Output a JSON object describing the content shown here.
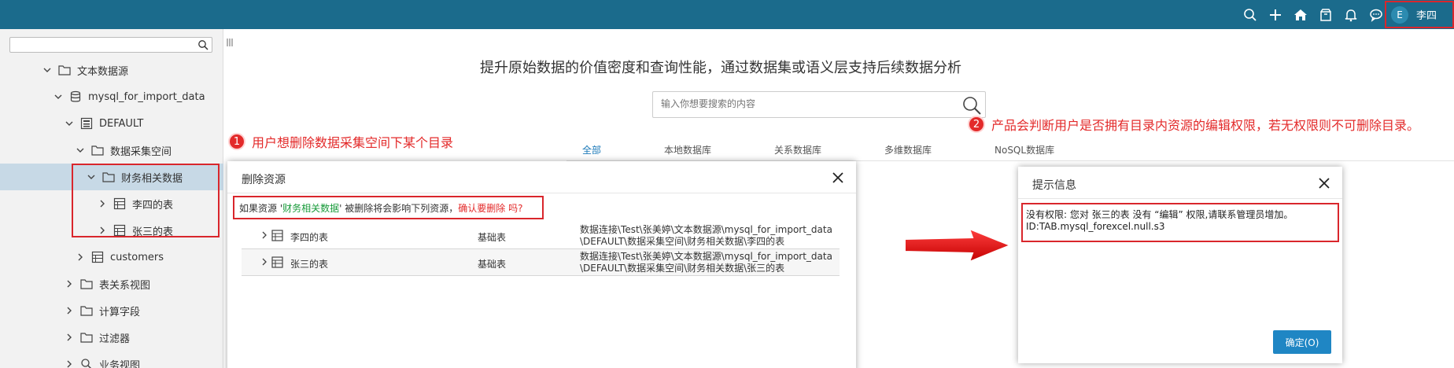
{
  "header": {
    "avatar_letter": "E",
    "user_name": "李四",
    "icons": [
      "search-icon",
      "plus-icon",
      "home-icon",
      "package-icon",
      "bell-icon",
      "chat-icon"
    ]
  },
  "sidebar": {
    "search_placeholder": "",
    "items": [
      {
        "label": "文本数据源",
        "icon": "folder-icon",
        "expanded": true
      },
      {
        "label": "mysql_for_import_data",
        "icon": "database-icon",
        "expanded": true
      },
      {
        "label": "DEFAULT",
        "icon": "schema-icon",
        "expanded": true
      },
      {
        "label": "数据采集空间",
        "icon": "folder-icon",
        "expanded": true
      },
      {
        "label": "财务相关数据",
        "icon": "folder-icon",
        "expanded": true
      },
      {
        "label": "李四的表",
        "icon": "table-icon",
        "expanded": false
      },
      {
        "label": "张三的表",
        "icon": "table-icon",
        "expanded": false
      },
      {
        "label": "customers",
        "icon": "table-icon",
        "expanded": false
      },
      {
        "label": "表关系视图",
        "icon": "folder-icon",
        "expanded": false
      },
      {
        "label": "计算字段",
        "icon": "folder-icon",
        "expanded": false
      },
      {
        "label": "过滤器",
        "icon": "folder-icon",
        "expanded": false
      },
      {
        "label": "业务视图",
        "icon": "search-icon",
        "expanded": false
      }
    ]
  },
  "main": {
    "title": "提升原始数据的价值密度和查询性能，通过数据集或语义层支持后续数据分析",
    "search_placeholder": "输入你想要搜索的内容",
    "tabs": [
      "全部",
      "本地数据库",
      "关系数据库",
      "多维数据库",
      "NoSQL数据库"
    ]
  },
  "annotations": {
    "first_num": "1",
    "first_text": "用户想删除数据采集空间下某个目录",
    "second_num": "2",
    "second_text": "产品会判断用户是否拥有目录内资源的编辑权限，若无权限则不可删除目录。"
  },
  "delete_dialog": {
    "title": "删除资源",
    "msg_prefix": "如果资源 '",
    "msg_resource": "财务相关数据",
    "msg_middle": "' 被删除将会影响下列资源，",
    "msg_confirm": "确认要删除 吗?",
    "rows": [
      {
        "name": "李四的表",
        "type": "基础表",
        "path1": "数据连接\\Test\\张美婷\\文本数据源\\mysql_for_import_data",
        "path2": "\\DEFAULT\\数据采集空间\\财务相关数据\\李四的表"
      },
      {
        "name": "张三的表",
        "type": "基础表",
        "path1": "数据连接\\Test\\张美婷\\文本数据源\\mysql_for_import_data",
        "path2": "\\DEFAULT\\数据采集空间\\财务相关数据\\张三的表"
      }
    ]
  },
  "info_dialog": {
    "title": "提示信息",
    "line1": "没有权限: 您对 张三的表 没有 “编辑” 权限,请联系管理员增加。",
    "line2": "ID:TAB.mysql_forexcel.null.s3",
    "ok_label": "确定(O)"
  },
  "colors": {
    "header_bg": "#1b6b8c",
    "annotation_red": "#e32a2a",
    "resource_green": "#189a3a",
    "primary_button": "#1f86c4",
    "tab_active": "#1b79b8",
    "selected_row": "#c7d9e6"
  }
}
